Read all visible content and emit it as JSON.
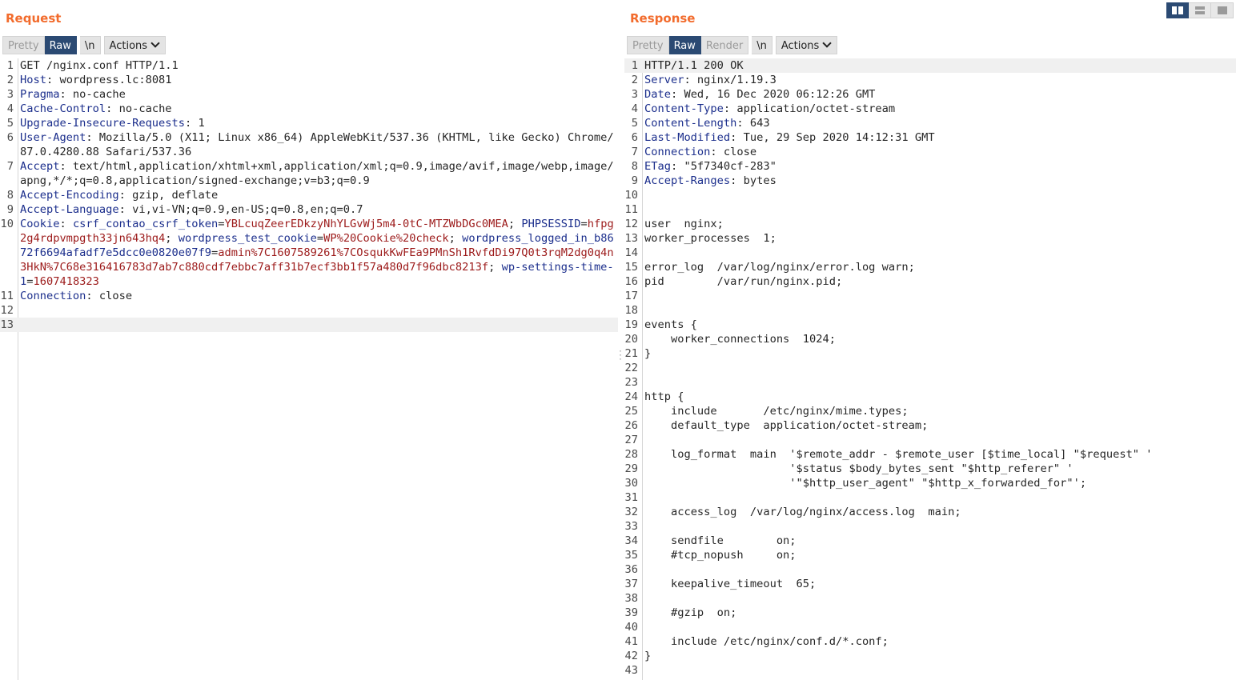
{
  "request": {
    "title": "Request",
    "tabs": [
      "Pretty",
      "Raw",
      "\\n"
    ],
    "active_tab": "Raw",
    "actions_label": "Actions",
    "current_line": 13,
    "lines": [
      {
        "n": "1",
        "parts": [
          {
            "t": "GET /nginx.conf HTTP/1.1"
          }
        ]
      },
      {
        "n": "2",
        "parts": [
          {
            "t": "Host",
            "c": "k"
          },
          {
            "t": ": wordpress.lc:8081"
          }
        ]
      },
      {
        "n": "3",
        "parts": [
          {
            "t": "Pragma",
            "c": "k"
          },
          {
            "t": ": no-cache"
          }
        ]
      },
      {
        "n": "4",
        "parts": [
          {
            "t": "Cache-Control",
            "c": "k"
          },
          {
            "t": ": no-cache"
          }
        ]
      },
      {
        "n": "5",
        "parts": [
          {
            "t": "Upgrade-Insecure-Requests",
            "c": "k"
          },
          {
            "t": ": 1"
          }
        ]
      },
      {
        "n": "6",
        "parts": [
          {
            "t": "User-Agent",
            "c": "k"
          },
          {
            "t": ": Mozilla/5.0 (X11; Linux x86_64) AppleWebKit/537.36 (KHTML, like Gecko) Chrome/87.0.4280.88 Safari/537.36"
          }
        ]
      },
      {
        "n": "7",
        "parts": [
          {
            "t": "Accept",
            "c": "k"
          },
          {
            "t": ": text/html,application/xhtml+xml,application/xml;q=0.9,image/avif,image/webp,image/apng,*/*;q=0.8,application/signed-exchange;v=b3;q=0.9"
          }
        ]
      },
      {
        "n": "8",
        "parts": [
          {
            "t": "Accept-Encoding",
            "c": "k"
          },
          {
            "t": ": gzip, deflate"
          }
        ]
      },
      {
        "n": "9",
        "parts": [
          {
            "t": "Accept-Language",
            "c": "k"
          },
          {
            "t": ": vi,vi-VN;q=0.9,en-US;q=0.8,en;q=0.7"
          }
        ]
      },
      {
        "n": "10",
        "parts": [
          {
            "t": "Cookie",
            "c": "k"
          },
          {
            "t": ": "
          },
          {
            "t": "csrf_contao_csrf_token",
            "c": "k"
          },
          {
            "t": "="
          },
          {
            "t": "YBLcuqZeerEDkzyNhYLGvWj5m4-0tC-MTZWbDGc0MEA",
            "c": "v"
          },
          {
            "t": "; "
          },
          {
            "t": "PHPSESSID",
            "c": "k"
          },
          {
            "t": "="
          },
          {
            "t": "hfpg2g4rdpvmpgth33jn643hq4",
            "c": "v"
          },
          {
            "t": "; "
          },
          {
            "t": "wordpress_test_cookie",
            "c": "k"
          },
          {
            "t": "="
          },
          {
            "t": "WP%20Cookie%20check",
            "c": "v"
          },
          {
            "t": "; "
          },
          {
            "t": "wordpress_logged_in_b8672f6694afadf7e5dcc0e0820e07f9",
            "c": "k"
          },
          {
            "t": "="
          },
          {
            "t": "admin%7C1607589261%7COsqukKwFEa9PMnSh1RvfdDi97Q0t3rqM2dg0q4n3HkN%7C68e316416783d7ab7c880cdf7ebbc7aff31b7ecf3bb1f57a480d7f96dbc8213f",
            "c": "v"
          },
          {
            "t": "; "
          },
          {
            "t": "wp-settings-time-1",
            "c": "k"
          },
          {
            "t": "="
          },
          {
            "t": "1607418323",
            "c": "v"
          }
        ]
      },
      {
        "n": "11",
        "parts": [
          {
            "t": "Connection",
            "c": "k"
          },
          {
            "t": ": close"
          }
        ]
      },
      {
        "n": "12",
        "parts": [
          {
            "t": ""
          }
        ]
      },
      {
        "n": "13",
        "parts": [
          {
            "t": ""
          }
        ]
      }
    ]
  },
  "response": {
    "title": "Response",
    "tabs": [
      "Pretty",
      "Raw",
      "Render",
      "\\n"
    ],
    "active_tab": "Raw",
    "actions_label": "Actions",
    "current_line": 1,
    "lines": [
      {
        "n": "1",
        "parts": [
          {
            "t": "HTTP/1.1 200 OK"
          }
        ]
      },
      {
        "n": "2",
        "parts": [
          {
            "t": "Server",
            "c": "k"
          },
          {
            "t": ": nginx/1.19.3"
          }
        ]
      },
      {
        "n": "3",
        "parts": [
          {
            "t": "Date",
            "c": "k"
          },
          {
            "t": ": Wed, 16 Dec 2020 06:12:26 GMT"
          }
        ]
      },
      {
        "n": "4",
        "parts": [
          {
            "t": "Content-Type",
            "c": "k"
          },
          {
            "t": ": application/octet-stream"
          }
        ]
      },
      {
        "n": "5",
        "parts": [
          {
            "t": "Content-Length",
            "c": "k"
          },
          {
            "t": ": 643"
          }
        ]
      },
      {
        "n": "6",
        "parts": [
          {
            "t": "Last-Modified",
            "c": "k"
          },
          {
            "t": ": Tue, 29 Sep 2020 14:12:31 GMT"
          }
        ]
      },
      {
        "n": "7",
        "parts": [
          {
            "t": "Connection",
            "c": "k"
          },
          {
            "t": ": close"
          }
        ]
      },
      {
        "n": "8",
        "parts": [
          {
            "t": "ETag",
            "c": "k"
          },
          {
            "t": ": \"5f7340cf-283\""
          }
        ]
      },
      {
        "n": "9",
        "parts": [
          {
            "t": "Accept-Ranges",
            "c": "k"
          },
          {
            "t": ": bytes"
          }
        ]
      },
      {
        "n": "10",
        "parts": [
          {
            "t": ""
          }
        ]
      },
      {
        "n": "11",
        "parts": [
          {
            "t": ""
          }
        ]
      },
      {
        "n": "12",
        "parts": [
          {
            "t": "user  nginx;"
          }
        ]
      },
      {
        "n": "13",
        "parts": [
          {
            "t": "worker_processes  1;"
          }
        ]
      },
      {
        "n": "14",
        "parts": [
          {
            "t": ""
          }
        ]
      },
      {
        "n": "15",
        "parts": [
          {
            "t": "error_log  /var/log/nginx/error.log warn;"
          }
        ]
      },
      {
        "n": "16",
        "parts": [
          {
            "t": "pid        /var/run/nginx.pid;"
          }
        ]
      },
      {
        "n": "17",
        "parts": [
          {
            "t": ""
          }
        ]
      },
      {
        "n": "18",
        "parts": [
          {
            "t": ""
          }
        ]
      },
      {
        "n": "19",
        "parts": [
          {
            "t": "events {"
          }
        ]
      },
      {
        "n": "20",
        "parts": [
          {
            "t": "    worker_connections  1024;"
          }
        ]
      },
      {
        "n": "21",
        "parts": [
          {
            "t": "}"
          }
        ]
      },
      {
        "n": "22",
        "parts": [
          {
            "t": ""
          }
        ]
      },
      {
        "n": "23",
        "parts": [
          {
            "t": ""
          }
        ]
      },
      {
        "n": "24",
        "parts": [
          {
            "t": "http {"
          }
        ]
      },
      {
        "n": "25",
        "parts": [
          {
            "t": "    include       /etc/nginx/mime.types;"
          }
        ]
      },
      {
        "n": "26",
        "parts": [
          {
            "t": "    default_type  application/octet-stream;"
          }
        ]
      },
      {
        "n": "27",
        "parts": [
          {
            "t": ""
          }
        ]
      },
      {
        "n": "28",
        "parts": [
          {
            "t": "    log_format  main  '$remote_addr - $remote_user [$time_local] \"$request\" '"
          }
        ]
      },
      {
        "n": "29",
        "parts": [
          {
            "t": "                      '$status $body_bytes_sent \"$http_referer\" '"
          }
        ]
      },
      {
        "n": "30",
        "parts": [
          {
            "t": "                      '\"$http_user_agent\" \"$http_x_forwarded_for\"';"
          }
        ]
      },
      {
        "n": "31",
        "parts": [
          {
            "t": ""
          }
        ]
      },
      {
        "n": "32",
        "parts": [
          {
            "t": "    access_log  /var/log/nginx/access.log  main;"
          }
        ]
      },
      {
        "n": "33",
        "parts": [
          {
            "t": ""
          }
        ]
      },
      {
        "n": "34",
        "parts": [
          {
            "t": "    sendfile        on;"
          }
        ]
      },
      {
        "n": "35",
        "parts": [
          {
            "t": "    #tcp_nopush     on;"
          }
        ]
      },
      {
        "n": "36",
        "parts": [
          {
            "t": ""
          }
        ]
      },
      {
        "n": "37",
        "parts": [
          {
            "t": "    keepalive_timeout  65;"
          }
        ]
      },
      {
        "n": "38",
        "parts": [
          {
            "t": ""
          }
        ]
      },
      {
        "n": "39",
        "parts": [
          {
            "t": "    #gzip  on;"
          }
        ]
      },
      {
        "n": "40",
        "parts": [
          {
            "t": ""
          }
        ]
      },
      {
        "n": "41",
        "parts": [
          {
            "t": "    include /etc/nginx/conf.d/*.conf;"
          }
        ]
      },
      {
        "n": "42",
        "parts": [
          {
            "t": "}"
          }
        ]
      },
      {
        "n": "43",
        "parts": [
          {
            "t": ""
          }
        ]
      }
    ]
  },
  "layout_buttons": [
    {
      "icon": "split-columns-icon",
      "active": true
    },
    {
      "icon": "split-rows-icon",
      "active": false
    },
    {
      "icon": "single-pane-icon",
      "active": false
    }
  ],
  "colors": {
    "accent": "#f26b2c",
    "active_tab": "#2b4a73",
    "header_key": "#1b2e8c",
    "cookie_value": "#9c1a1a"
  }
}
